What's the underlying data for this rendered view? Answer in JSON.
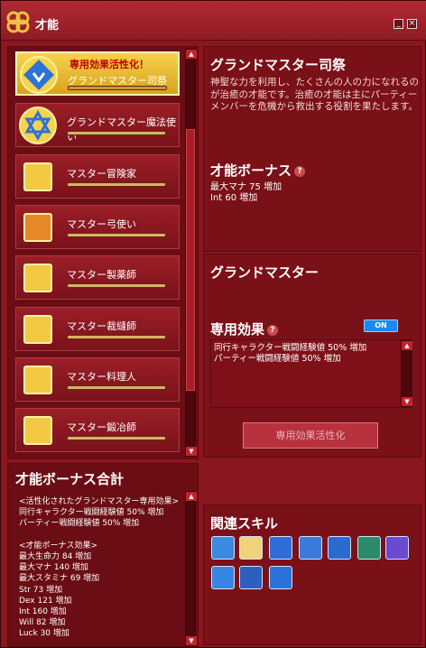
{
  "window": {
    "title": "才能"
  },
  "talents": [
    {
      "label": "グランドマスター司祭",
      "badge": "専用効果活性化！",
      "selected": true,
      "icon": "priest-grandmaster-icon"
    },
    {
      "label": "グランドマスター魔法使い",
      "icon": "hexagram-icon"
    },
    {
      "label": "マスター冒険家",
      "icon": "compass-icon"
    },
    {
      "label": "マスター弓使い",
      "icon": "bow-icon"
    },
    {
      "label": "マスター製薬師",
      "icon": "potion-icon"
    },
    {
      "label": "マスター裁縫師",
      "icon": "scissors-icon"
    },
    {
      "label": "マスター料理人",
      "icon": "chef-hat-icon"
    },
    {
      "label": "マスター鍛冶師",
      "icon": "anvil-icon"
    }
  ],
  "detail": {
    "title": "グランドマスター司祭",
    "description": "神聖な力を利用し、たくさんの人の力になれるのが治癒の才能です。治癒の才能は主にパーティーメンバーを危機から救出する役割を果たします。",
    "bonus_title": "才能ボーナス",
    "bonus_lines": [
      "最大マナ 75 増加",
      "Int 60 増加"
    ]
  },
  "grandmaster": {
    "title": "グランドマスター",
    "effect_title": "専用効果",
    "toggle": "ON",
    "effects": [
      "同行キャラクター戦闘経験値 50% 増加",
      "パーティー戦闘経験値 50% 増加"
    ],
    "activate_button": "専用効果活性化"
  },
  "total_bonus": {
    "title": "才能ボーナス合計",
    "lines": [
      "<活性化されたグランドマスター専用効果>",
      "同行キャラクター戦闘経験値 50% 増加",
      "パーティー戦闘経験値 50% 増加",
      "",
      "<才能ボーナス効果>",
      "最大生命力 84 増加",
      "最大マナ 140 増加",
      "最大スタミナ 69 増加",
      "Str 73 増加",
      "Dex 121 増加",
      "Int 160 増加",
      "Will 82 増加",
      "Luck 30 増加"
    ]
  },
  "related_skills": {
    "title": "関連スキル",
    "icons": [
      "party-healing-icon",
      "healing-scroll-icon",
      "shield-icon",
      "heart-wings-icon",
      "arrow-slash-icon",
      "green-arrow-icon",
      "rainbow-arrow-icon",
      "blue-slash-icon",
      "guardian-icon",
      "star-of-david-icon"
    ]
  },
  "colors": {
    "selected": "#f3c843",
    "accent_on": "#1b8af0",
    "panel": "#7a1018"
  }
}
